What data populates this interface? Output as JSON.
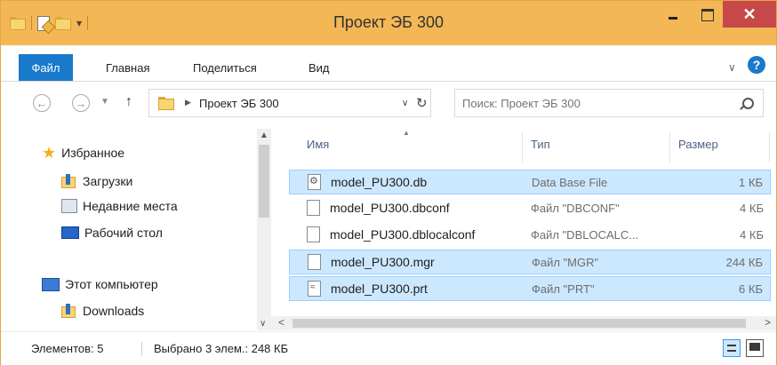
{
  "window": {
    "title": "Проект ЭБ 300"
  },
  "ribbon": {
    "tabs": [
      "Файл",
      "Главная",
      "Поделиться",
      "Вид"
    ]
  },
  "address": {
    "path": "Проект ЭБ 300"
  },
  "search": {
    "placeholder": "Поиск: Проект ЭБ 300"
  },
  "nav": {
    "favorites": "Избранное",
    "favorite_items": [
      "Загрузки",
      "Недавние места",
      "Рабочий стол"
    ],
    "computer": "Этот компьютер",
    "computer_items": [
      "Downloads"
    ]
  },
  "columns": {
    "name": "Имя",
    "type": "Тип",
    "size": "Размер"
  },
  "files": [
    {
      "name": "model_PU300.db",
      "type": "Data Base File",
      "size": "1 КБ",
      "selected": true,
      "icon": "db-file-icon"
    },
    {
      "name": "model_PU300.dbconf",
      "type": "Файл \"DBCONF\"",
      "size": "4 КБ",
      "selected": false,
      "icon": "file-icon"
    },
    {
      "name": "model_PU300.dblocalconf",
      "type": "Файл \"DBLOCALC...",
      "size": "4 КБ",
      "selected": false,
      "icon": "file-icon"
    },
    {
      "name": "model_PU300.mgr",
      "type": "Файл \"MGR\"",
      "size": "244 КБ",
      "selected": true,
      "icon": "file-icon"
    },
    {
      "name": "model_PU300.prt",
      "type": "Файл \"PRT\"",
      "size": "6 КБ",
      "selected": true,
      "icon": "prt-file-icon"
    }
  ],
  "status": {
    "count": "Элементов: 5",
    "selection": "Выбрано 3 элем.: 248 КБ"
  },
  "colors": {
    "titlebar": "#f4b755",
    "accent": "#1979ca",
    "selection": "#cce8ff",
    "close": "#c74848"
  }
}
